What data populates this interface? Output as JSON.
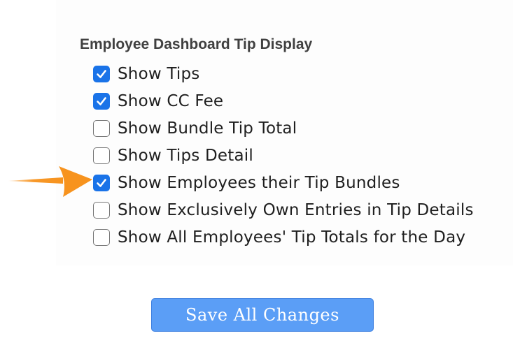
{
  "section": {
    "title": "Employee Dashboard Tip Display"
  },
  "options": [
    {
      "label": "Show Tips",
      "checked": true
    },
    {
      "label": "Show CC Fee",
      "checked": true
    },
    {
      "label": "Show Bundle Tip Total",
      "checked": false
    },
    {
      "label": "Show Tips Detail",
      "checked": false
    },
    {
      "label": "Show Employees their Tip Bundles",
      "checked": true
    },
    {
      "label": "Show Exclusively Own Entries in Tip Details",
      "checked": false
    },
    {
      "label": "Show All Employees' Tip Totals for the Day",
      "checked": false
    }
  ],
  "annotation": {
    "arrow_color": "#f7931e",
    "icon": "arrow-right-icon"
  },
  "actions": {
    "save_label": "Save All Changes"
  },
  "colors": {
    "checkbox_checked": "#1a73e8",
    "button": "#5b9ef6"
  }
}
